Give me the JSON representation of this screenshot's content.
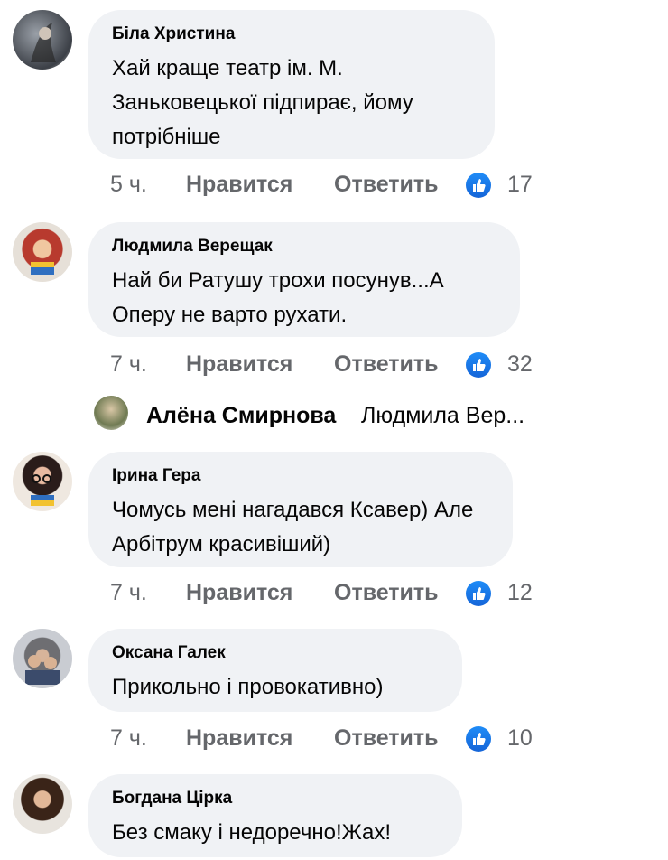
{
  "labels": {
    "like": "Нравится",
    "reply": "Ответить"
  },
  "comments": [
    {
      "author": "Біла Христина",
      "text": "Хай краще театр ім. М. Заньковецької підпирає, йому потрібніше",
      "time": "5 ч.",
      "likes": "17"
    },
    {
      "author": "Людмила Верещак",
      "text": "Най би Ратушу трохи посунув...А Оперу не варто рухати.",
      "time": "7 ч.",
      "likes": "32"
    },
    {
      "author": "Ірина Гера",
      "text": "Чомусь мені нагадався Ксавер) Але Арбітрум красивіший)",
      "time": "7 ч.",
      "likes": "12"
    },
    {
      "author": "Оксана Галек",
      "text": "Прикольно і провокативно)",
      "time": "7 ч.",
      "likes": "10"
    },
    {
      "author": "Богдана Цірка",
      "text": "Без смаку і недоречно!Жах!"
    }
  ],
  "reply_preview": {
    "author": "Алёна Смирнова",
    "text": "Людмила Вер..."
  },
  "colors": {
    "like_blue": "#1877f2",
    "bubble": "#f0f2f5",
    "meta": "#65676b"
  },
  "icons": {
    "like": "thumbs-up-icon"
  }
}
